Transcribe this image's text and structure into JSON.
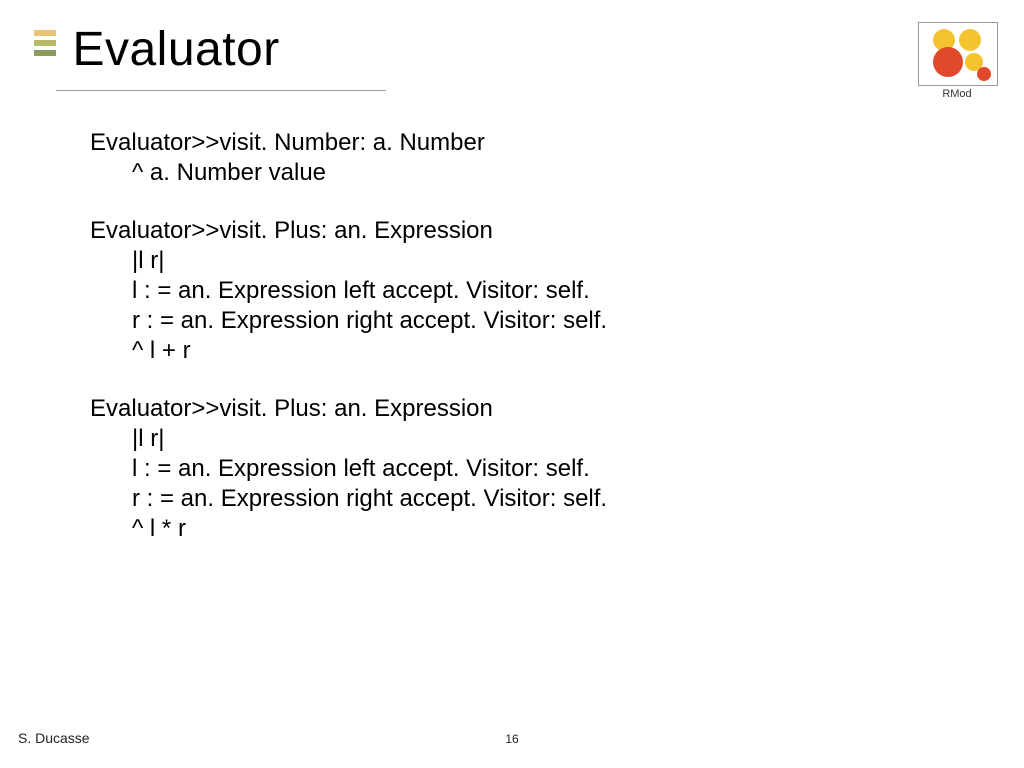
{
  "title": "Evaluator",
  "logo_label": "RMod",
  "code": {
    "method1": {
      "sig": "Evaluator>>visit. Number: a. Number",
      "l1": "^ a. Number value"
    },
    "method2": {
      "sig": "Evaluator>>visit. Plus: an. Expression",
      "l1": "|l r|",
      "l2": "l : = an. Expression left accept. Visitor: self.",
      "l3": "r : = an. Expression right accept. Visitor: self.",
      "l4": "^ l + r"
    },
    "method3": {
      "sig": "Evaluator>>visit. Plus: an. Expression",
      "l1": "|l r|",
      "l2": "l : = an. Expression left accept. Visitor: self.",
      "l3": "r : = an. Expression right accept. Visitor: self.",
      "l4": "^ l * r"
    }
  },
  "footer": {
    "author": "S. Ducasse",
    "page": "16"
  }
}
